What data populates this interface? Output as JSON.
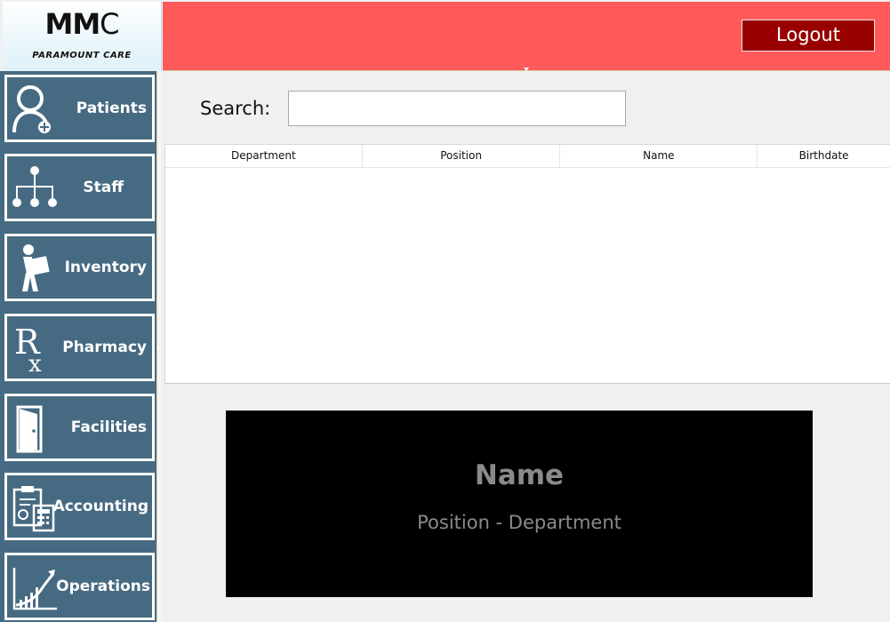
{
  "logo": {
    "mark_bold": "MM",
    "mark_thin": "C",
    "subtitle": "PARAMOUNT CARE"
  },
  "header": {
    "logout_label": "Logout"
  },
  "sidebar": {
    "items": [
      {
        "label": "Patients",
        "icon": "patient-icon"
      },
      {
        "label": "Staff",
        "icon": "org-chart-icon"
      },
      {
        "label": "Inventory",
        "icon": "person-carrying-box-icon"
      },
      {
        "label": "Pharmacy",
        "icon": "rx-icon"
      },
      {
        "label": "Facilities",
        "icon": "door-icon"
      },
      {
        "label": "Accounting",
        "icon": "calculator-clipboard-icon"
      },
      {
        "label": "Operations",
        "icon": "growth-chart-icon"
      }
    ]
  },
  "search": {
    "label": "Search:",
    "value": "",
    "placeholder": ""
  },
  "table": {
    "columns": [
      "Department",
      "Position",
      "Name",
      "Birthdate"
    ],
    "rows": []
  },
  "profile": {
    "name": "Name",
    "subtitle": "Position - Department"
  },
  "colors": {
    "header": "#ff5a5a",
    "logout": "#990000",
    "sidebar": "#466a82",
    "profile_bg": "#000000",
    "profile_text": "#8a8a8a"
  }
}
